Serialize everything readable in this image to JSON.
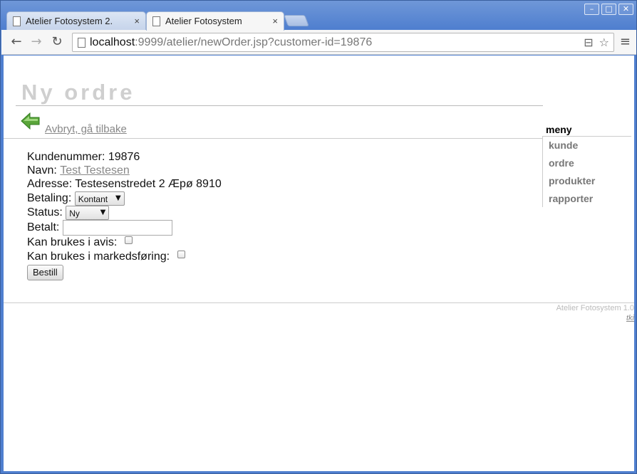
{
  "window": {
    "controls": {
      "minimize": "–",
      "maximize": "□",
      "close": "✕"
    }
  },
  "tabs": [
    {
      "title": "Atelier Fotosystem 2.",
      "close": "×"
    },
    {
      "title": "Atelier Fotosystem",
      "close": "×"
    }
  ],
  "toolbar": {
    "back": "←",
    "forward": "→",
    "reload": "↻",
    "url_host": "localhost",
    "url_rest": ":9999/atelier/newOrder.jsp?customer-id=19876",
    "translate_icon": "⊟",
    "bookmark_icon": "☆",
    "menu_icon": "≡"
  },
  "page": {
    "title": "Ny ordre",
    "back_link": "Avbryt, gå tilbake"
  },
  "sidebar": {
    "title": "meny",
    "items": [
      "kunde",
      "ordre",
      "produkter",
      "rapporter"
    ]
  },
  "form": {
    "customer_number_label": "Kundenummer: 19876",
    "name_label": "Navn:",
    "name_value": "Test Testesen ",
    "address_label": "Adresse: Testesenstredet 2 Æpø 8910",
    "payment_label": "Betaling:",
    "payment_value": "Kontant",
    "status_label": "Status:",
    "status_value": "Ny",
    "paid_label": "Betalt:",
    "paid_value": "",
    "newspaper_label": "Kan brukes i avis:",
    "marketing_label": "Kan brukes i markedsføring:",
    "submit_label": "Bestill"
  },
  "footer": {
    "version": "Atelier Fotosystem 1.0",
    "link": "tki"
  },
  "colors": {
    "title": "#cfcfcf",
    "link": "#888888",
    "arrow_green": "#5aa53a"
  }
}
